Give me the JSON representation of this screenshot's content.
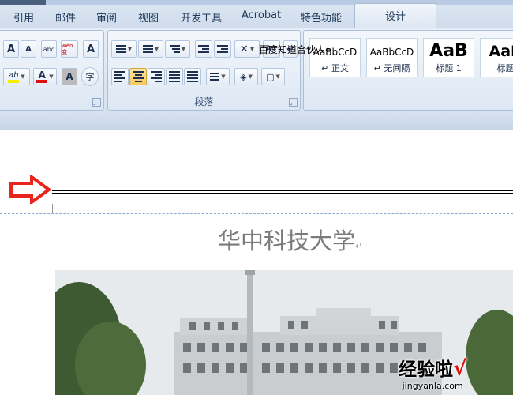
{
  "tabs": [
    {
      "label": "引用",
      "active": false
    },
    {
      "label": "邮件",
      "active": false
    },
    {
      "label": "审阅",
      "active": false
    },
    {
      "label": "视图",
      "active": false
    },
    {
      "label": "开发工具",
      "active": false
    },
    {
      "label": "Acrobat",
      "active": false
    },
    {
      "label": "特色功能",
      "active": false
    },
    {
      "label": "设计",
      "active": true
    }
  ],
  "ribbon": {
    "font_group": {
      "buttons": [
        "A",
        "A",
        "abc",
        "wén 变",
        "A",
        "ab",
        "A",
        "A",
        "字"
      ]
    },
    "paragraph_group": {
      "label": "段落"
    },
    "styles_group": {
      "styles": [
        {
          "sample": "AaBbCcD",
          "name": "↵ 正文"
        },
        {
          "sample": "AaBbCcD",
          "name": "↵ 无间隔"
        },
        {
          "sample": "AaB",
          "name": "标题 1"
        },
        {
          "sample": "AaB",
          "name": "标题"
        }
      ]
    }
  },
  "document": {
    "header_text": "百度知道合伙人↵",
    "title": "华中科技大学",
    "paragraph_mark": "↵",
    "watermark_main": "经验啦",
    "watermark_check": "√",
    "watermark_url": "jingyanla.com"
  },
  "colors": {
    "highlight_yellow": "#f5f000",
    "font_red": "#e01010",
    "arrow_red": "#e8241c",
    "accent_blue": "#1e395b"
  }
}
